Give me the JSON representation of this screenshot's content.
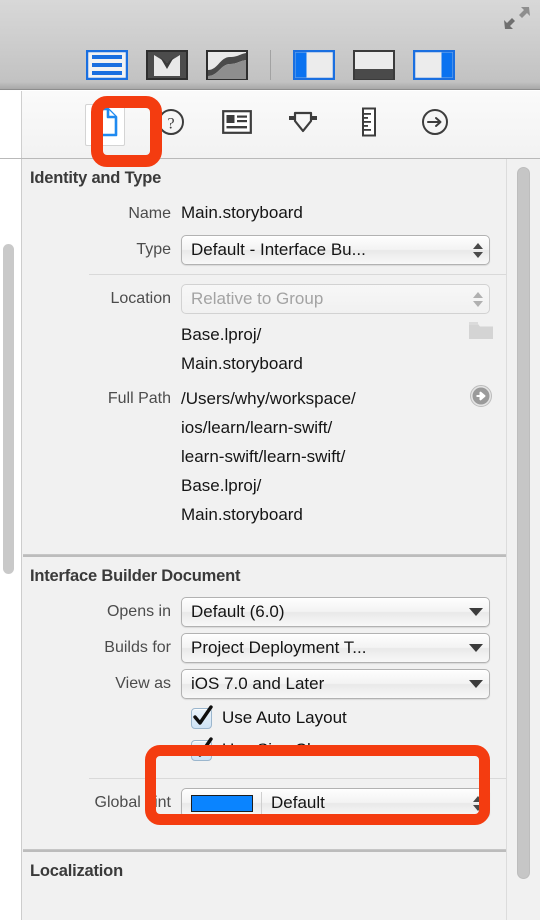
{
  "window": {
    "resize_icon": "expand-arrows-icon"
  },
  "toolbar": {
    "editor_group_label": "Editor",
    "buttons": [
      {
        "name": "standard-editor",
        "label": "Standard Editor",
        "active": true
      },
      {
        "name": "assistant-editor",
        "label": "Assistant Editor",
        "active": false
      },
      {
        "name": "version-editor",
        "label": "Version Editor",
        "active": false
      }
    ],
    "view_toggles": [
      {
        "name": "navigator-toggle",
        "label": "Hide or show the Navigator",
        "active": true
      },
      {
        "name": "debug-toggle",
        "label": "Hide or show the Debug area",
        "active": false
      },
      {
        "name": "utilities-toggle",
        "label": "Hide or show the Utilities",
        "active": true
      }
    ]
  },
  "inspector_tabs": [
    {
      "name": "file-inspector-tab",
      "icon": "document-icon",
      "label": "File Inspector",
      "selected": true
    },
    {
      "name": "quick-help-tab",
      "icon": "question-mark-circle-icon",
      "label": "Quick Help Inspector",
      "selected": false
    },
    {
      "name": "identity-inspector-tab",
      "icon": "id-card-icon",
      "label": "Identity Inspector",
      "selected": false
    },
    {
      "name": "attributes-inspector-tab",
      "icon": "downward-shield-icon",
      "label": "Attributes Inspector",
      "selected": false
    },
    {
      "name": "size-inspector-tab",
      "icon": "ruler-icon",
      "label": "Size Inspector",
      "selected": false
    },
    {
      "name": "connections-inspector-tab",
      "icon": "arrow-right-circle-icon",
      "label": "Connections Inspector",
      "selected": false
    }
  ],
  "sections": {
    "identity_and_type": {
      "title": "Identity and Type",
      "name_label": "Name",
      "name_value": "Main.storyboard",
      "type_label": "Type",
      "type_value": "Default - Interface Bu...",
      "location_label": "Location",
      "location_value": "Relative to Group",
      "relative_path": "Base.lproj/\nMain.storyboard",
      "full_path_label": "Full Path",
      "full_path_value": "/Users/why/workspace/\nios/learn/learn-swift/\nlearn-swift/learn-swift/\nBase.lproj/\nMain.storyboard",
      "choose_folder_icon": "folder-icon",
      "reveal_icon": "arrow-right-circle-icon"
    },
    "interface_builder_document": {
      "title": "Interface Builder Document",
      "opens_in_label": "Opens in",
      "opens_in_value": "Default (6.0)",
      "builds_for_label": "Builds for",
      "builds_for_value": "Project Deployment T...",
      "view_as_label": "View as",
      "view_as_value": "iOS 7.0 and Later",
      "checkboxes": [
        {
          "name": "use-auto-layout-checkbox",
          "label": "Use Auto Layout",
          "checked": true
        },
        {
          "name": "use-size-classes-checkbox",
          "label": "Use Size Classes",
          "checked": true
        }
      ],
      "global_tint_label": "Global Tint",
      "global_tint_value": "Default",
      "global_tint_color": "#0a84ff"
    },
    "localization": {
      "title": "Localization"
    }
  },
  "annotations": {
    "color": "#f43c10",
    "highlight_file_inspector_tab": "file-inspector-tab-highlight",
    "highlight_checkboxes": "auto-layout-size-classes-highlight"
  }
}
